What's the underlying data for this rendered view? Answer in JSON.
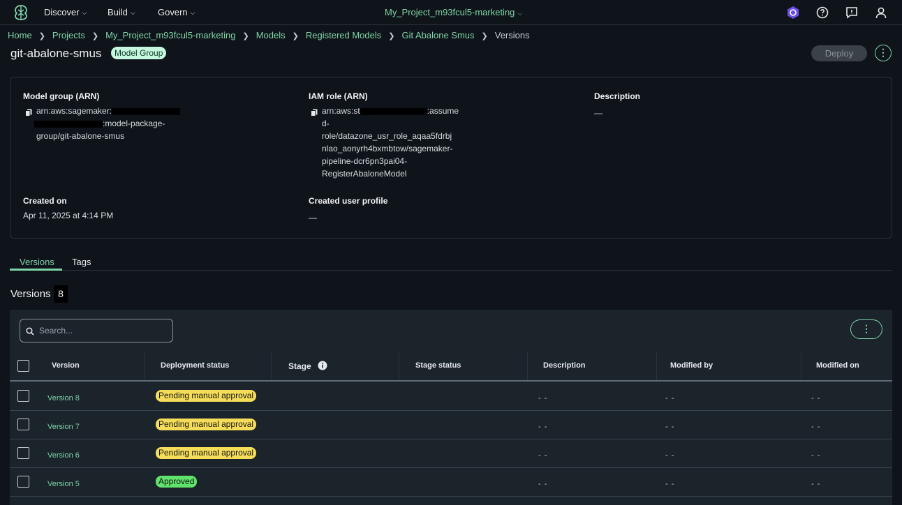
{
  "topbar": {
    "nav": [
      "Discover",
      "Build",
      "Govern"
    ],
    "project": "My_Project_m93fcul5-marketing"
  },
  "breadcrumb": [
    "Home",
    "Projects",
    "My_Project_m93fcul5-marketing",
    "Models",
    "Registered Models",
    "Git Abalone Smus",
    "Versions"
  ],
  "header": {
    "title": "git-abalone-smus",
    "badge": "Model Group",
    "deploy_label": "Deploy",
    "menu_glyph": "⋮"
  },
  "details": {
    "model_group_label": "Model group (ARN)",
    "model_group_line1": "arn:aws:sagemaker:",
    "model_group_line2": ":model-package-",
    "model_group_line3": "group/git-abalone-smus",
    "iam_label": "IAM role (ARN)",
    "iam_prefix": "arn:aws:st",
    "iam_suffix": ":assume",
    "iam_lines": [
      "d-",
      "role/datazone_usr_role_aqaa5fdrbj",
      "nlao_aonyrh4bxmbtow/sagemaker-",
      "pipeline-dcr6pn3pai04-",
      "RegisterAbaloneModel"
    ],
    "description_label": "Description",
    "description_value": "—",
    "created_on_label": "Created on",
    "created_on_value": "Apr 11, 2025 at 4:14 PM",
    "created_profile_label": "Created user profile",
    "created_profile_value": "—"
  },
  "tabs": [
    "Versions",
    "Tags"
  ],
  "versions": {
    "heading": "Versions",
    "count": "8",
    "search_placeholder": "Search...",
    "columns": [
      "Version",
      "Deployment status",
      "Stage",
      "Stage status",
      "Description",
      "Modified by",
      "Modified on"
    ],
    "rows": [
      {
        "version": "Version 8",
        "status": "Pending manual approval",
        "description": "- -",
        "modified_by": "- -",
        "modified_on": "- -"
      },
      {
        "version": "Version 7",
        "status": "Pending manual approval",
        "description": "- -",
        "modified_by": "- -",
        "modified_on": "- -"
      },
      {
        "version": "Version 6",
        "status": "Pending manual approval",
        "description": "- -",
        "modified_by": "- -",
        "modified_on": "- -"
      },
      {
        "version": "Version 5",
        "status": "Approved",
        "description": "- -",
        "modified_by": "- -",
        "modified_on": "- -"
      }
    ]
  },
  "colors": {
    "accent": "#7fd3a8",
    "pending": "#f5dd5a",
    "approved": "#5fe36b",
    "background": "#0f141a",
    "table_bg": "#1b232b"
  }
}
